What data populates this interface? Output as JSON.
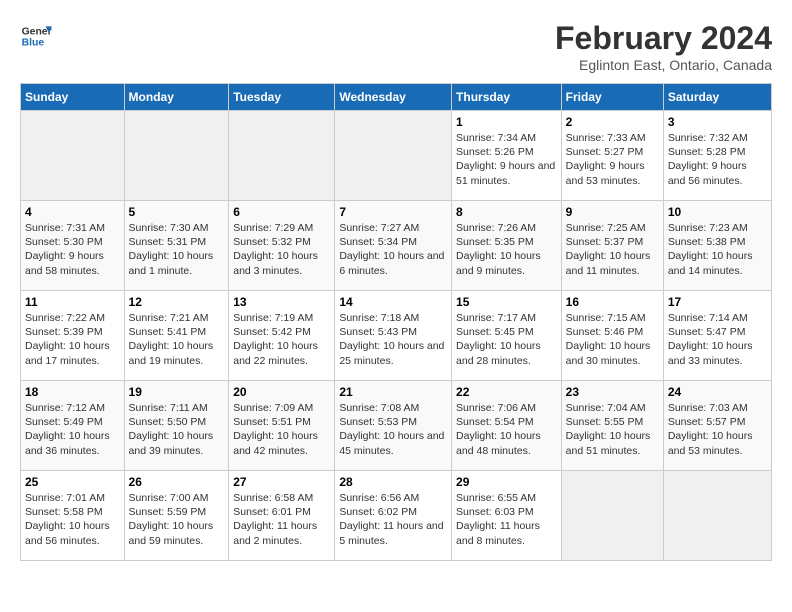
{
  "header": {
    "logo_line1": "General",
    "logo_line2": "Blue",
    "title": "February 2024",
    "subtitle": "Eglinton East, Ontario, Canada"
  },
  "calendar": {
    "days_of_week": [
      "Sunday",
      "Monday",
      "Tuesday",
      "Wednesday",
      "Thursday",
      "Friday",
      "Saturday"
    ],
    "weeks": [
      [
        {
          "day": "",
          "info": ""
        },
        {
          "day": "",
          "info": ""
        },
        {
          "day": "",
          "info": ""
        },
        {
          "day": "",
          "info": ""
        },
        {
          "day": "1",
          "info": "Sunrise: 7:34 AM\nSunset: 5:26 PM\nDaylight: 9 hours and 51 minutes."
        },
        {
          "day": "2",
          "info": "Sunrise: 7:33 AM\nSunset: 5:27 PM\nDaylight: 9 hours and 53 minutes."
        },
        {
          "day": "3",
          "info": "Sunrise: 7:32 AM\nSunset: 5:28 PM\nDaylight: 9 hours and 56 minutes."
        }
      ],
      [
        {
          "day": "4",
          "info": "Sunrise: 7:31 AM\nSunset: 5:30 PM\nDaylight: 9 hours and 58 minutes."
        },
        {
          "day": "5",
          "info": "Sunrise: 7:30 AM\nSunset: 5:31 PM\nDaylight: 10 hours and 1 minute."
        },
        {
          "day": "6",
          "info": "Sunrise: 7:29 AM\nSunset: 5:32 PM\nDaylight: 10 hours and 3 minutes."
        },
        {
          "day": "7",
          "info": "Sunrise: 7:27 AM\nSunset: 5:34 PM\nDaylight: 10 hours and 6 minutes."
        },
        {
          "day": "8",
          "info": "Sunrise: 7:26 AM\nSunset: 5:35 PM\nDaylight: 10 hours and 9 minutes."
        },
        {
          "day": "9",
          "info": "Sunrise: 7:25 AM\nSunset: 5:37 PM\nDaylight: 10 hours and 11 minutes."
        },
        {
          "day": "10",
          "info": "Sunrise: 7:23 AM\nSunset: 5:38 PM\nDaylight: 10 hours and 14 minutes."
        }
      ],
      [
        {
          "day": "11",
          "info": "Sunrise: 7:22 AM\nSunset: 5:39 PM\nDaylight: 10 hours and 17 minutes."
        },
        {
          "day": "12",
          "info": "Sunrise: 7:21 AM\nSunset: 5:41 PM\nDaylight: 10 hours and 19 minutes."
        },
        {
          "day": "13",
          "info": "Sunrise: 7:19 AM\nSunset: 5:42 PM\nDaylight: 10 hours and 22 minutes."
        },
        {
          "day": "14",
          "info": "Sunrise: 7:18 AM\nSunset: 5:43 PM\nDaylight: 10 hours and 25 minutes."
        },
        {
          "day": "15",
          "info": "Sunrise: 7:17 AM\nSunset: 5:45 PM\nDaylight: 10 hours and 28 minutes."
        },
        {
          "day": "16",
          "info": "Sunrise: 7:15 AM\nSunset: 5:46 PM\nDaylight: 10 hours and 30 minutes."
        },
        {
          "day": "17",
          "info": "Sunrise: 7:14 AM\nSunset: 5:47 PM\nDaylight: 10 hours and 33 minutes."
        }
      ],
      [
        {
          "day": "18",
          "info": "Sunrise: 7:12 AM\nSunset: 5:49 PM\nDaylight: 10 hours and 36 minutes."
        },
        {
          "day": "19",
          "info": "Sunrise: 7:11 AM\nSunset: 5:50 PM\nDaylight: 10 hours and 39 minutes."
        },
        {
          "day": "20",
          "info": "Sunrise: 7:09 AM\nSunset: 5:51 PM\nDaylight: 10 hours and 42 minutes."
        },
        {
          "day": "21",
          "info": "Sunrise: 7:08 AM\nSunset: 5:53 PM\nDaylight: 10 hours and 45 minutes."
        },
        {
          "day": "22",
          "info": "Sunrise: 7:06 AM\nSunset: 5:54 PM\nDaylight: 10 hours and 48 minutes."
        },
        {
          "day": "23",
          "info": "Sunrise: 7:04 AM\nSunset: 5:55 PM\nDaylight: 10 hours and 51 minutes."
        },
        {
          "day": "24",
          "info": "Sunrise: 7:03 AM\nSunset: 5:57 PM\nDaylight: 10 hours and 53 minutes."
        }
      ],
      [
        {
          "day": "25",
          "info": "Sunrise: 7:01 AM\nSunset: 5:58 PM\nDaylight: 10 hours and 56 minutes."
        },
        {
          "day": "26",
          "info": "Sunrise: 7:00 AM\nSunset: 5:59 PM\nDaylight: 10 hours and 59 minutes."
        },
        {
          "day": "27",
          "info": "Sunrise: 6:58 AM\nSunset: 6:01 PM\nDaylight: 11 hours and 2 minutes."
        },
        {
          "day": "28",
          "info": "Sunrise: 6:56 AM\nSunset: 6:02 PM\nDaylight: 11 hours and 5 minutes."
        },
        {
          "day": "29",
          "info": "Sunrise: 6:55 AM\nSunset: 6:03 PM\nDaylight: 11 hours and 8 minutes."
        },
        {
          "day": "",
          "info": ""
        },
        {
          "day": "",
          "info": ""
        }
      ]
    ]
  }
}
